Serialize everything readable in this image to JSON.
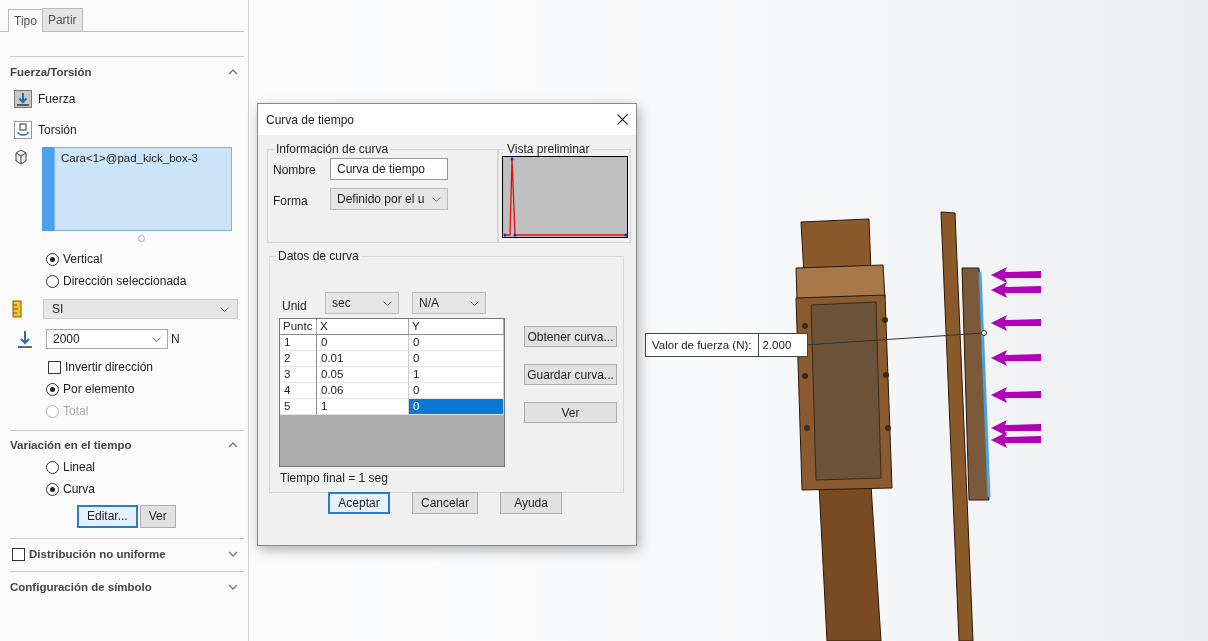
{
  "tabs": [
    {
      "label": "Tipo",
      "selected": true
    },
    {
      "label": "Partir",
      "selected": false
    }
  ],
  "force_section": {
    "title": "Fuerza/Torsión",
    "expanded": true,
    "modes": [
      {
        "label": "Fuerza",
        "selected": true
      },
      {
        "label": "Torsión",
        "selected": false
      }
    ],
    "selection": "Cara<1>@pad_kick_box-3",
    "direction_options": [
      {
        "label": "Vertical",
        "selected": true,
        "disabled": false
      },
      {
        "label": "Dirección seleccionada",
        "selected": false,
        "disabled": false
      }
    ],
    "unit_system": "SI",
    "force_value": "2000",
    "force_unit": "N",
    "reverse": {
      "label": "Invertir dirección",
      "checked": false
    },
    "distribution_options": [
      {
        "label": "Por elemento",
        "selected": true,
        "disabled": false
      },
      {
        "label": "Total",
        "selected": false,
        "disabled": true
      }
    ]
  },
  "time_section": {
    "title": "Variación en el tiempo",
    "expanded": true,
    "options": [
      {
        "label": "Lineal",
        "selected": false,
        "disabled": false
      },
      {
        "label": "Curva",
        "selected": true,
        "disabled": false
      }
    ],
    "buttons": [
      {
        "label": "Editar...",
        "focused": true
      },
      {
        "label": "Ver",
        "focused": false
      }
    ]
  },
  "nonuniform_section": {
    "label": "Distribución no uniforme",
    "checked": false,
    "expanded": false
  },
  "symbol_section": {
    "title": "Configuración de símbolo",
    "expanded": false
  },
  "dialog": {
    "title": "Curva de tiempo",
    "info_group": "Información de curva",
    "name_label": "Nombre",
    "name_value": "Curva de tiempo",
    "shape_label": "Forma",
    "shape_value": "Definido por el u",
    "preview_label": "Vista preliminar",
    "data_group": "Datos de curva",
    "unit_label": "Unid",
    "x_unit": "sec",
    "y_unit": "N/A",
    "columns": [
      "Puntc",
      "X",
      "Y"
    ],
    "rows": [
      [
        {
          "text": "1",
          "selected": false
        },
        {
          "text": "0",
          "selected": false
        },
        {
          "text": "0",
          "selected": false
        }
      ],
      [
        {
          "text": "2",
          "selected": false
        },
        {
          "text": "0.01",
          "selected": false
        },
        {
          "text": "0",
          "selected": false
        }
      ],
      [
        {
          "text": "3",
          "selected": false
        },
        {
          "text": "0.05",
          "selected": false
        },
        {
          "text": "1",
          "selected": false
        }
      ],
      [
        {
          "text": "4",
          "selected": false
        },
        {
          "text": "0.06",
          "selected": false
        },
        {
          "text": "0",
          "selected": false
        }
      ],
      [
        {
          "text": "5",
          "selected": false
        },
        {
          "text": "1",
          "selected": false
        },
        {
          "text": "0",
          "selected": true
        }
      ]
    ],
    "side_buttons": [
      "Obtener curva...",
      "Guardar curva...",
      "Ver"
    ],
    "footer": "Tiempo final = 1 seg",
    "buttons": [
      {
        "label": "Aceptar",
        "focused": true
      },
      {
        "label": "Cancelar",
        "focused": false
      },
      {
        "label": "Ayuda",
        "focused": false
      }
    ]
  },
  "callout": {
    "label": "Valor de fuerza (N):",
    "value": "2.000"
  }
}
